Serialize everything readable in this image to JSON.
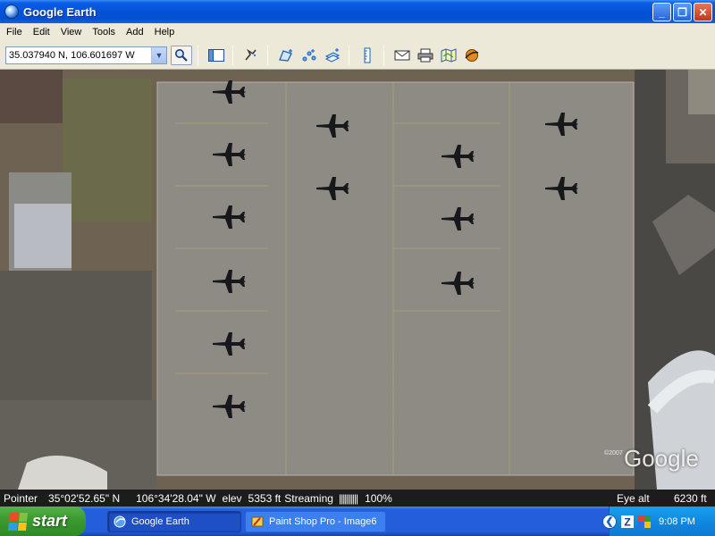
{
  "window": {
    "title": "Google Earth",
    "buttons": {
      "minimize": "_",
      "maximize": "❐",
      "close": "✕"
    }
  },
  "menu": [
    "File",
    "Edit",
    "View",
    "Tools",
    "Add",
    "Help"
  ],
  "toolbar": {
    "coordinates_value": "35.037940 N, 106.601697 W",
    "icons": [
      "search-icon",
      "sidebar-toggle-icon",
      "placemark-icon",
      "polygon-icon",
      "path-icon",
      "overlay-icon",
      "ruler-icon",
      "email-icon",
      "print-icon",
      "maps-icon",
      "sky-icon"
    ]
  },
  "map": {
    "copyright": "©2007",
    "watermark": "Google"
  },
  "statusbar": {
    "pointer_label": "Pointer",
    "lat": "35°02'52.65\" N",
    "lon": "106°34'28.04\" W",
    "elev_label": "elev",
    "elev": "5353 ft",
    "streaming_label": "Streaming",
    "streaming_bar": "||||||||||",
    "streaming_pct": "100%",
    "eye_label": "Eye alt",
    "eye_alt": "6230 ft"
  },
  "taskbar": {
    "start_label": "start",
    "tasks": [
      {
        "label": "Google Earth",
        "active": true
      },
      {
        "label": "Paint Shop Pro - Image6",
        "active": false
      }
    ],
    "clock": "9:08 PM"
  },
  "colors": {
    "titlebar": "#0552d8",
    "taskbar": "#245edb",
    "start_button": "#3c9b31",
    "tray": "#0f89e0",
    "chrome": "#ece9d8"
  }
}
